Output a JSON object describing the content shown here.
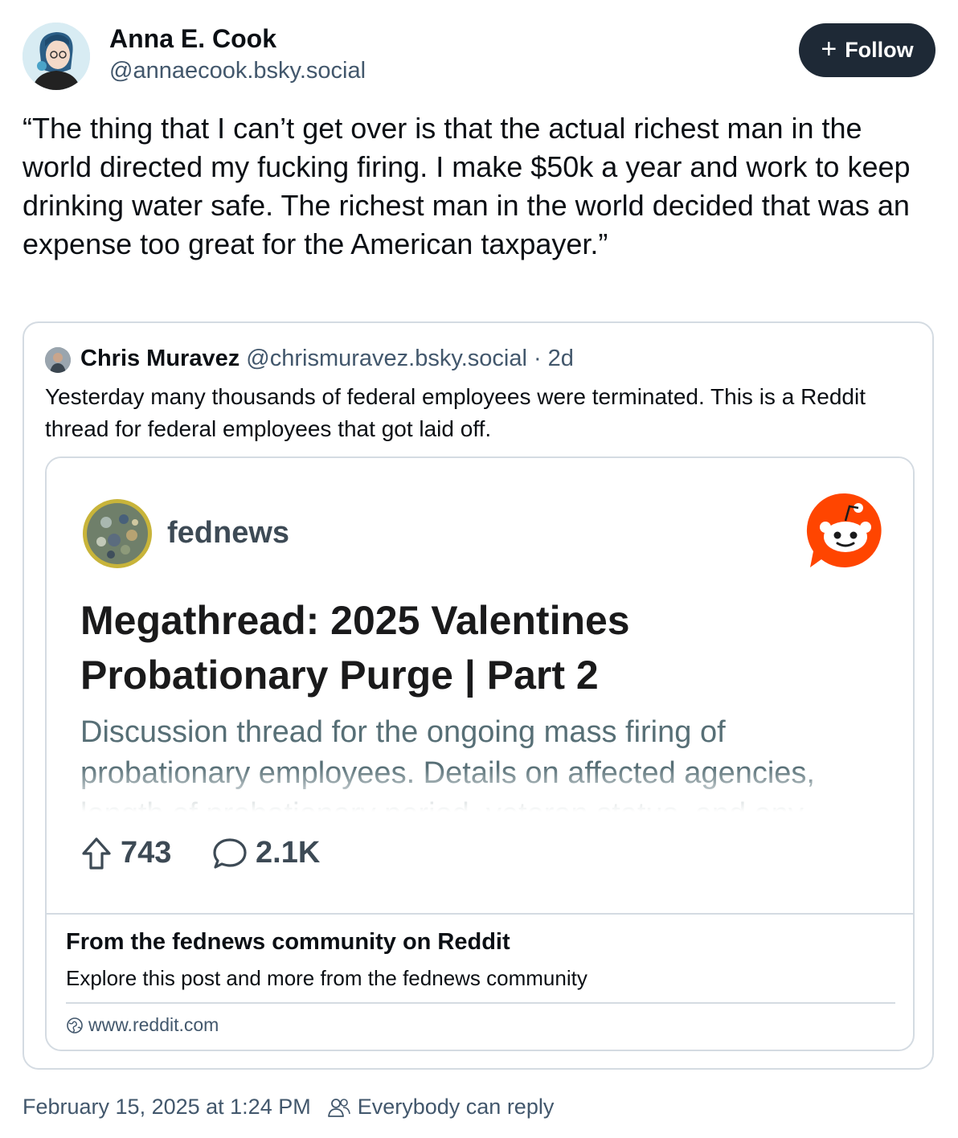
{
  "author": {
    "display_name": "Anna E. Cook",
    "handle": "@annaecook.bsky.social"
  },
  "follow_button": {
    "label": "Follow",
    "icon": "plus-icon"
  },
  "post": {
    "text": "“The thing that I can’t get over is that the actual richest man in the world directed my fucking firing. I make $50k a year and work to keep drinking water safe. The richest man in the world decided that was an expense too great for the American taxpayer.”",
    "timestamp": "February 15, 2025 at 1:24 PM",
    "reply_setting": "Everybody can reply"
  },
  "quote": {
    "display_name": "Chris Muravez",
    "handle": "@chrismuravez.bsky.social",
    "age": "· 2d",
    "text": "Yesterday many thousands of federal employees were terminated. This is a Reddit thread for federal employees that got laid off."
  },
  "embed": {
    "subreddit": "fednews",
    "thread_title": "Megathread: 2025 Valentines Probationary Purge | Part 2",
    "thread_description": "Discussion thread for the ongoing mass firing of probationary employees. Details on affected agencies, length of probationary period, veteran status, and any",
    "upvotes": "743",
    "comments": "2.1K",
    "card_title": "From the fednews community on Reddit",
    "card_description": "Explore this post and more from the fednews community",
    "domain": "www.reddit.com"
  },
  "colors": {
    "follow_bg": "#1e2936",
    "muted_text": "#42576c",
    "border": "#d4dbe2",
    "reddit_orange": "#ff4500"
  }
}
